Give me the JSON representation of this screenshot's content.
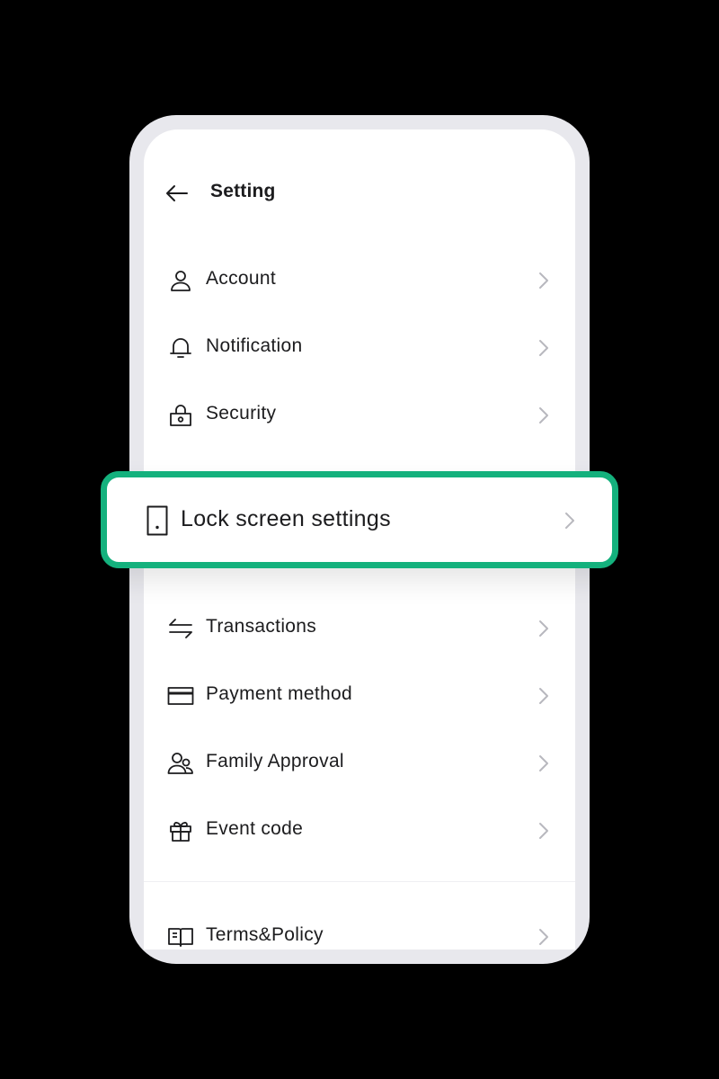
{
  "header": {
    "title": "Setting",
    "back_icon": "arrow-left-icon"
  },
  "menu_top": [
    {
      "label": "Account",
      "icon": "user-icon"
    },
    {
      "label": "Notification",
      "icon": "bell-icon"
    },
    {
      "label": "Security",
      "icon": "lock-icon"
    }
  ],
  "highlighted": {
    "label": "Lock screen settings",
    "icon": "phone-icon"
  },
  "menu_bottom": [
    {
      "label": "Transactions",
      "icon": "transfer-icon"
    },
    {
      "label": "Payment method",
      "icon": "card-icon"
    },
    {
      "label": "Family Approval",
      "icon": "users-icon"
    },
    {
      "label": "Event code",
      "icon": "gift-icon"
    }
  ],
  "menu_footer": [
    {
      "label": "Terms&Policy",
      "icon": "book-icon"
    }
  ],
  "colors": {
    "accent": "#14b17d",
    "frame": "#e8e8ed",
    "background": "#000000",
    "chevron": "#b8b8be"
  }
}
